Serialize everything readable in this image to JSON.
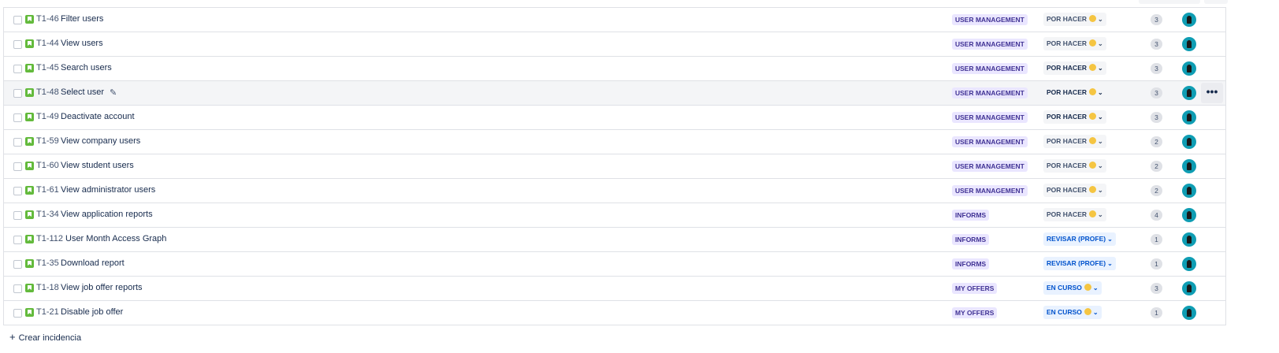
{
  "issues": [
    {
      "key": "T1-46",
      "summary": "Filter users",
      "epic": "USER MANAGEMENT",
      "status": "POR HACER",
      "points": "3"
    },
    {
      "key": "T1-44",
      "summary": "View users",
      "epic": "USER MANAGEMENT",
      "status": "POR HACER",
      "points": "3"
    },
    {
      "key": "T1-45",
      "summary": "Search users",
      "epic": "USER MANAGEMENT",
      "status": "POR HACER",
      "points": "3"
    },
    {
      "key": "T1-48",
      "summary": "Select user",
      "epic": "USER MANAGEMENT",
      "status": "POR HACER",
      "points": "3"
    },
    {
      "key": "T1-49",
      "summary": "Deactivate account",
      "epic": "USER MANAGEMENT",
      "status": "POR HACER",
      "points": "3"
    },
    {
      "key": "T1-59",
      "summary": "View company users",
      "epic": "USER MANAGEMENT",
      "status": "POR HACER",
      "points": "2"
    },
    {
      "key": "T1-60",
      "summary": "View student users",
      "epic": "USER MANAGEMENT",
      "status": "POR HACER",
      "points": "2"
    },
    {
      "key": "T1-61",
      "summary": "View administrator users",
      "epic": "USER MANAGEMENT",
      "status": "POR HACER",
      "points": "2"
    },
    {
      "key": "T1-34",
      "summary": "View application reports",
      "epic": "INFORMS",
      "status": "POR HACER",
      "points": "4"
    },
    {
      "key": "T1-112",
      "summary": "User Month Access Graph",
      "epic": "INFORMS",
      "status": "REVISAR (PROFE)",
      "points": "1"
    },
    {
      "key": "T1-35",
      "summary": "Download report",
      "epic": "INFORMS",
      "status": "REVISAR (PROFE)",
      "points": "1"
    },
    {
      "key": "T1-18",
      "summary": "View job offer reports",
      "epic": "MY OFFERS",
      "status": "EN CURSO",
      "points": "3"
    },
    {
      "key": "T1-21",
      "summary": "Disable job offer",
      "epic": "MY OFFERS",
      "status": "EN CURSO",
      "points": "1"
    }
  ],
  "create_issue_label": "Crear incidencia",
  "more_actions_label": "•••",
  "icons": {
    "issue_type": "story-icon",
    "edit": "pencil-icon",
    "status_chevron": "chevron-down-icon",
    "assignee": "avatar",
    "create": "plus-icon"
  },
  "colors": {
    "story": "#63ba3c",
    "epic_bg": "#eae6ff",
    "epic_text": "#403294",
    "status_todo_bg": "#f4f5f7",
    "status_blue_bg": "#e9f2ff",
    "status_blue_text": "#0052cc",
    "avatar": "#0f9db3"
  }
}
